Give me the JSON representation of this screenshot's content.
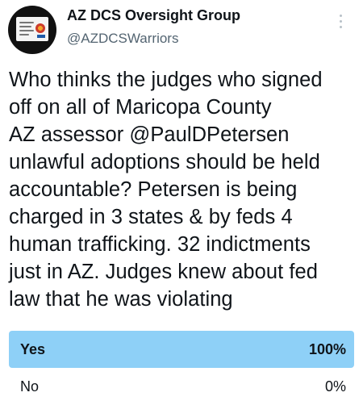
{
  "author": {
    "name": "AZ DCS Oversight Group",
    "handle": "@AZDCSWarriors",
    "avatar_icon": "organization-logo-icon"
  },
  "menu_icon": "more-vertical-icon",
  "tweet": {
    "text_lines": [
      "Who thinks the judges who signed",
      "off on all of Maricopa County",
      "AZ assessor @PaulDPetersen",
      "unlawful adoptions should be held",
      "accountable? Petersen is being",
      "charged in 3 states & by feds 4",
      "human trafficking. 32 indictments",
      "just in AZ. Judges knew about fed",
      "law that he was violating"
    ]
  },
  "poll": {
    "accent_color": "#8ed0f7",
    "options": [
      {
        "label": "Yes",
        "percent_label": "100%",
        "percent": 100,
        "winner": true
      },
      {
        "label": "No",
        "percent_label": "0%",
        "percent": 0,
        "winner": false
      }
    ]
  }
}
